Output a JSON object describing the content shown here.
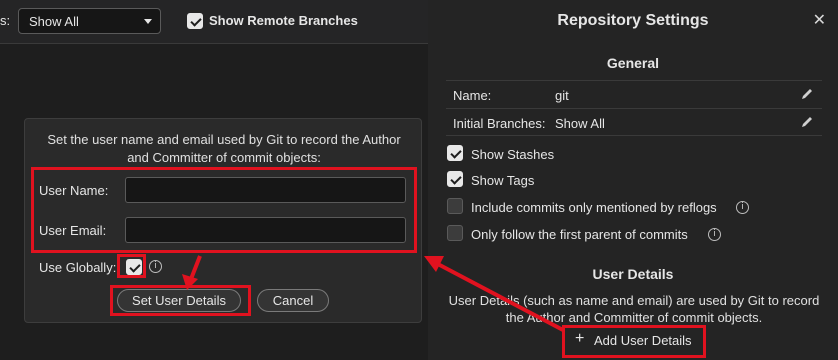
{
  "toolbar": {
    "partial_label": "s:",
    "branch_filter": "Show All",
    "show_remote_branches": "Show Remote Branches",
    "show_remote_checked": true
  },
  "panel": {
    "title": "Repository Settings",
    "close_icon": "close-icon",
    "general": {
      "title": "General",
      "rows": [
        {
          "key": "Name:",
          "value": "git",
          "icon": "pencil-icon"
        },
        {
          "key": "Initial Branches:",
          "value": "Show All",
          "icon": "pencil-icon"
        }
      ],
      "options": [
        {
          "label": "Show Stashes",
          "checked": true,
          "info": false
        },
        {
          "label": "Show Tags",
          "checked": true,
          "info": false
        },
        {
          "label": "Include commits only mentioned by reflogs",
          "checked": false,
          "info": true
        },
        {
          "label": "Only follow the first parent of commits",
          "checked": false,
          "info": true
        }
      ]
    },
    "user_details": {
      "title": "User Details",
      "description_line1": "User Details (such as name and email) are used by Git to record",
      "description_line2": "the Author and Committer of commit objects.",
      "add_button": "Add User Details",
      "add_icon": "plus-icon"
    }
  },
  "dialog": {
    "message_line1": "Set the user name and email used by Git to record the Author",
    "message_line2": "and Committer of commit objects:",
    "user_name_label": "User Name:",
    "user_name_value": "",
    "user_email_label": "User Email:",
    "user_email_value": "",
    "use_globally_label": "Use Globally:",
    "use_globally_checked": true,
    "set_button": "Set User Details",
    "cancel_button": "Cancel"
  },
  "colors": {
    "annotation": "#e0121f",
    "background": "#1e1e1e",
    "panel": "#242424"
  }
}
